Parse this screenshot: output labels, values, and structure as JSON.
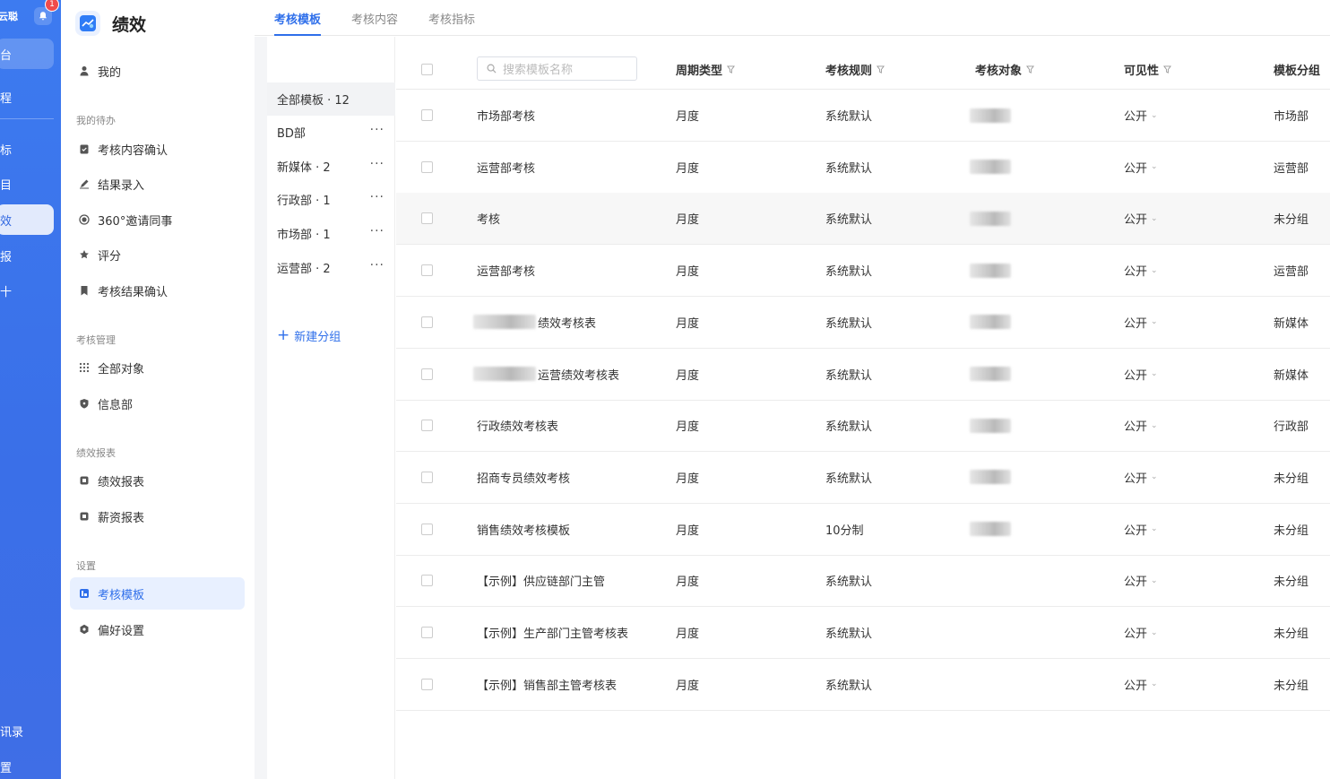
{
  "rail": {
    "brand": "云聪",
    "badge": "1",
    "items": [
      {
        "label": "台"
      },
      {
        "label": "程"
      },
      {
        "label": "标"
      },
      {
        "label": "目"
      },
      {
        "label": "效"
      },
      {
        "label": "报"
      },
      {
        "label": "十"
      },
      {
        "label": "讯录"
      },
      {
        "label": "置"
      }
    ]
  },
  "app": {
    "title": "绩效"
  },
  "nav": {
    "my": "我的",
    "group_todo": "我的待办",
    "todo": [
      "考核内容确认",
      "结果录入",
      "360°邀请同事",
      "评分",
      "考核结果确认"
    ],
    "group_manage": "考核管理",
    "manage": [
      "全部对象",
      "信息部"
    ],
    "group_report": "绩效报表",
    "report": [
      "绩效报表",
      "薪资报表"
    ],
    "group_settings": "设置",
    "settings": [
      "考核模板",
      "偏好设置"
    ]
  },
  "tabs": [
    "考核模板",
    "考核内容",
    "考核指标"
  ],
  "groups": {
    "items": [
      "全部模板 · 12",
      "BD部",
      "新媒体 · 2",
      "行政部 · 1",
      "市场部 · 1",
      "运营部 · 2"
    ],
    "more": "···",
    "new_group": "新建分组"
  },
  "table": {
    "search_placeholder": "搜索模板名称",
    "headers": {
      "cycle": "周期类型",
      "rule": "考核规则",
      "target": "考核对象",
      "visibility": "可见性",
      "group": "模板分组"
    },
    "rows": [
      {
        "name": "市场部考核",
        "cycle": "月度",
        "rule": "系统默认",
        "visibility": "公开",
        "group": "市场部"
      },
      {
        "name": "运营部考核",
        "cycle": "月度",
        "rule": "系统默认",
        "visibility": "公开",
        "group": "运营部"
      },
      {
        "name": "考核",
        "cycle": "月度",
        "rule": "系统默认",
        "visibility": "公开",
        "group": "未分组"
      },
      {
        "name": "运营部考核",
        "cycle": "月度",
        "rule": "系统默认",
        "visibility": "公开",
        "group": "运营部"
      },
      {
        "name": "绩效考核表",
        "cycle": "月度",
        "rule": "系统默认",
        "visibility": "公开",
        "group": "新媒体"
      },
      {
        "name": "运营绩效考核表",
        "cycle": "月度",
        "rule": "系统默认",
        "visibility": "公开",
        "group": "新媒体"
      },
      {
        "name": "行政绩效考核表",
        "cycle": "月度",
        "rule": "系统默认",
        "visibility": "公开",
        "group": "行政部"
      },
      {
        "name": "招商专员绩效考核",
        "cycle": "月度",
        "rule": "系统默认",
        "visibility": "公开",
        "group": "未分组"
      },
      {
        "name": "销售绩效考核模板",
        "cycle": "月度",
        "rule": "10分制",
        "visibility": "公开",
        "group": "未分组"
      },
      {
        "name": "【示例】供应链部门主管",
        "cycle": "月度",
        "rule": "系统默认",
        "visibility": "公开",
        "group": "未分组"
      },
      {
        "name": "【示例】生产部门主管考核表",
        "cycle": "月度",
        "rule": "系统默认",
        "visibility": "公开",
        "group": "未分组"
      },
      {
        "name": "【示例】销售部主管考核表",
        "cycle": "月度",
        "rule": "系统默认",
        "visibility": "公开",
        "group": "未分组"
      }
    ]
  },
  "colors": {
    "accent": "#2f6fea",
    "rail": "#3d7bf0",
    "badge": "#f04b4b"
  }
}
